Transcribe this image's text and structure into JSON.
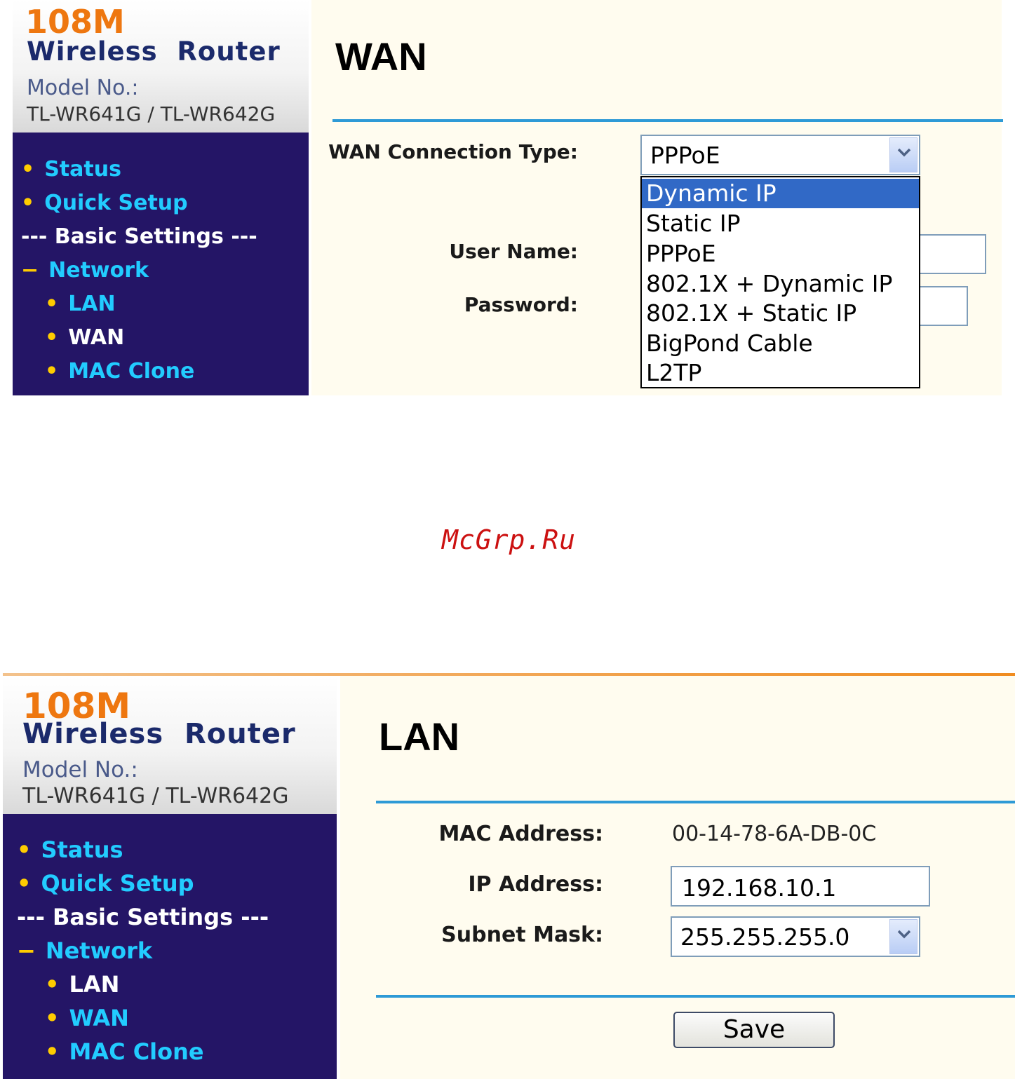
{
  "brand": {
    "speed": "108M",
    "product": "Wireless  Router",
    "model_label": "Model No.:",
    "model": "TL-WR641G / TL-WR642G"
  },
  "menu": {
    "status": "Status",
    "quick_setup": "Quick Setup",
    "basic_settings": "--- Basic Settings ---",
    "network_prefix": "−",
    "network": "Network",
    "lan": "LAN",
    "wan": "WAN",
    "mac_clone": "MAC Clone"
  },
  "wan_panel": {
    "title": "WAN",
    "connection_type_label": "WAN Connection Type:",
    "connection_type_value": "PPPoE",
    "options": [
      "Dynamic IP",
      "Static IP",
      "PPPoE",
      "802.1X + Dynamic IP",
      "802.1X + Static IP",
      "BigPond Cable",
      "L2TP"
    ],
    "highlighted_option": "Dynamic IP",
    "user_name_label": "User Name:",
    "password_label": "Password:"
  },
  "lan_panel": {
    "title": "LAN",
    "mac_label": "MAC Address:",
    "mac_value": "00-14-78-6A-DB-0C",
    "ip_label": "IP Address:",
    "ip_value": "192.168.10.1",
    "mask_label": "Subnet Mask:",
    "mask_value": "255.255.255.0",
    "save_label": "Save"
  },
  "watermark": "McGrp.Ru",
  "colors": {
    "sidebar_bg": "#241566",
    "link": "#22ccff",
    "accent_line": "#2e9ad6",
    "brand_orange": "#ee7710",
    "content_bg": "#fffcef",
    "selected_option": "#3169c6"
  }
}
